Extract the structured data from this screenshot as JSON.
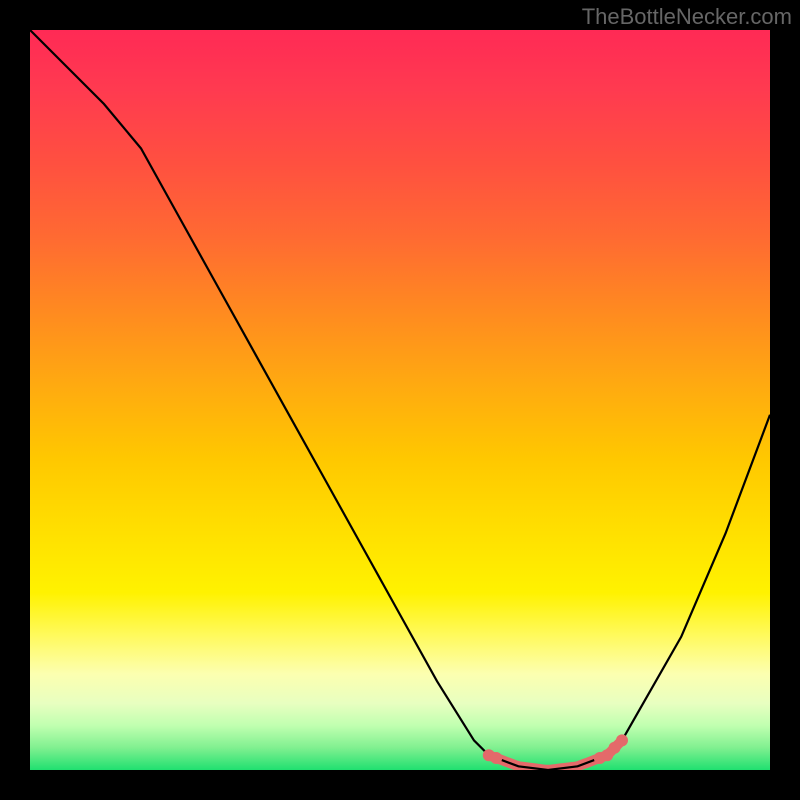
{
  "watermark": "TheBottleNecker.com",
  "chart_data": {
    "type": "line",
    "title": "",
    "xlabel": "",
    "ylabel": "",
    "xlim": [
      0,
      100
    ],
    "ylim": [
      0,
      100
    ],
    "series": [
      {
        "name": "curve",
        "x": [
          0,
          5,
          10,
          15,
          20,
          25,
          30,
          35,
          40,
          45,
          50,
          55,
          60,
          62,
          66,
          70,
          74,
          78,
          80,
          88,
          94,
          100
        ],
        "y": [
          100,
          95,
          90,
          84,
          75,
          66,
          57,
          48,
          39,
          30,
          21,
          12,
          4,
          2,
          0.5,
          0,
          0.5,
          2,
          4,
          18,
          32,
          48
        ]
      }
    ],
    "highlight_range_x": [
      62,
      80
    ],
    "highlight_dots_x": [
      62,
      63,
      77,
      78,
      79,
      80
    ],
    "grid": false,
    "legend": false
  }
}
